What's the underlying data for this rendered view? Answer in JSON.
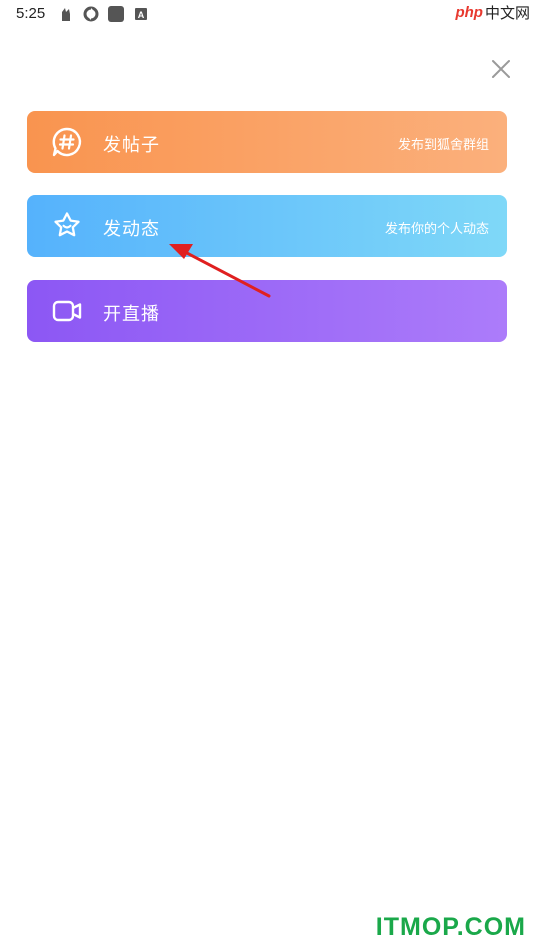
{
  "status_bar": {
    "time": "5:25",
    "icons": [
      "app-notification-icon",
      "sync-icon",
      "square-app-icon",
      "a-app-icon"
    ]
  },
  "watermark_top": {
    "php": "php",
    "text": "中文网"
  },
  "close": {
    "icon": "close-icon"
  },
  "actions": [
    {
      "title": "发帖子",
      "subtitle": "发布到狐舍群组",
      "icon": "hashtag-chat-icon",
      "color": "#f9944f"
    },
    {
      "title": "发动态",
      "subtitle": "发布你的个人动态",
      "icon": "star-smile-icon",
      "color": "#55b2fc"
    },
    {
      "title": "开直播",
      "subtitle": "",
      "icon": "video-camera-icon",
      "color": "#8c57f4"
    }
  ],
  "annotation": {
    "arrow_color": "#e02020"
  },
  "watermark_bottom": "ITMOP.COM"
}
